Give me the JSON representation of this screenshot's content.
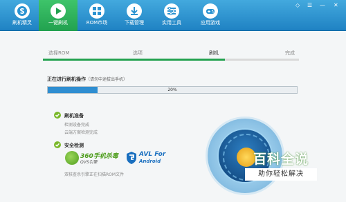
{
  "toolbar": {
    "buttons": [
      {
        "label": "刷机精灵",
        "icon": "s-logo-icon"
      },
      {
        "label": "一键刷机",
        "icon": "play-icon"
      },
      {
        "label": "ROM市场",
        "icon": "grid-icon"
      },
      {
        "label": "下载管理",
        "icon": "download-icon"
      },
      {
        "label": "实用工具",
        "icon": "tools-icon"
      },
      {
        "label": "应用游戏",
        "icon": "gamepad-icon"
      }
    ],
    "active_index": 1,
    "window_controls": [
      "◇",
      "☰",
      "—",
      "✕"
    ]
  },
  "steps": {
    "items": [
      "选择ROM",
      "选项",
      "刷机",
      "完成"
    ],
    "current_index": 2,
    "progress_fraction": 0.71
  },
  "progress": {
    "title": "正在进行刷机操作",
    "note": "（请勿中途拔出手机）",
    "value_text": "20%",
    "value_fraction": 0.2
  },
  "checks": {
    "prep": {
      "title": "刷机准备",
      "lines": [
        "检测设备完成",
        "云端方案检测完成"
      ]
    },
    "security": {
      "title": "安全检测",
      "status": "双核查杀引擎正在扫描ROM文件"
    }
  },
  "logos": {
    "brand360": {
      "main": "360手机杀毒",
      "sub": "QVS引擎"
    },
    "avl": {
      "main": "AVL For",
      "sub": "Android"
    }
  },
  "watermark": {
    "main": "百科全说",
    "sub": "助你轻松解决"
  },
  "colors": {
    "toolbar": "#2b93d1",
    "active_tab": "#22a14f",
    "progress": "#2f8ed1",
    "check": "#7ab82a"
  }
}
